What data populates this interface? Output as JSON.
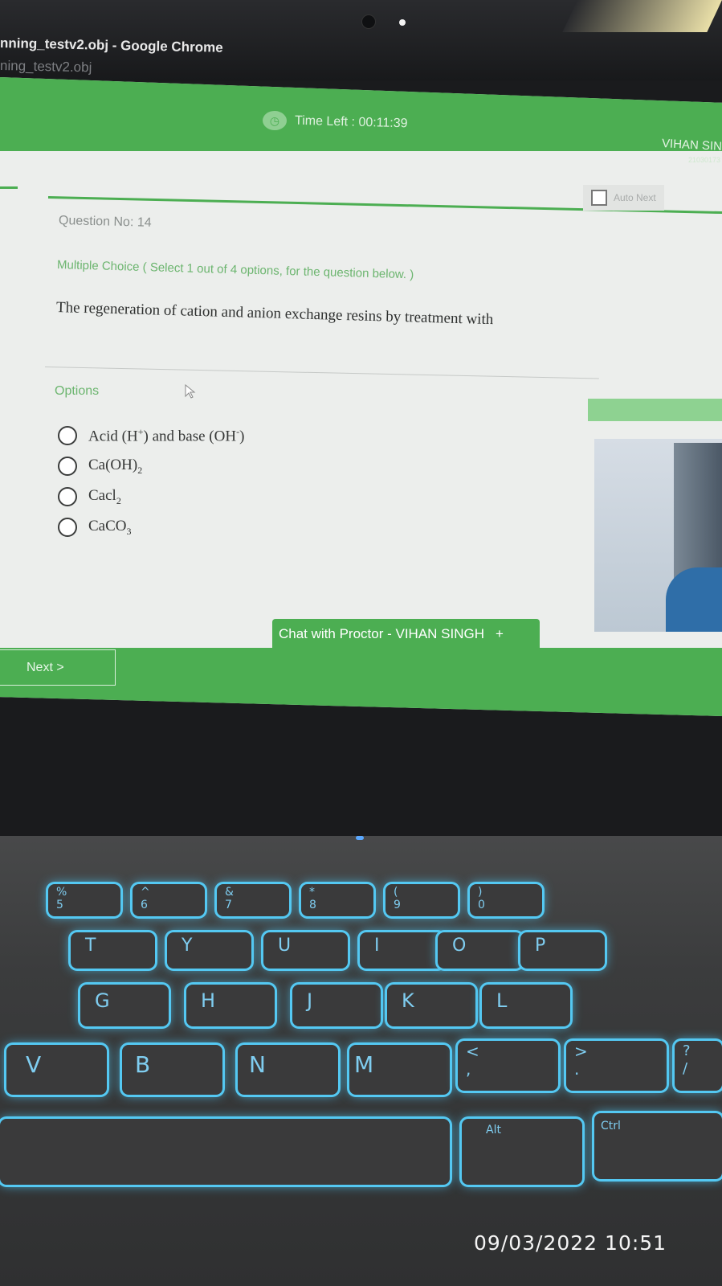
{
  "browser": {
    "window_title": "nning_testv2.obj - Google Chrome",
    "tab_title": "ning_testv2.obj"
  },
  "header": {
    "timer_label": "Time Left : 00:11:39",
    "user_name": "VIHAN SIN",
    "user_id": "21030173"
  },
  "toolbar": {
    "auto_next_label": "Auto Next"
  },
  "question": {
    "number_label": "Question No: 14",
    "type_label": "Multiple Choice ( Select 1 out of 4 options, for the question below. )",
    "text": "The regeneration of cation and anion exchange resins by treatment with"
  },
  "options": {
    "label": "Options",
    "items": [
      {
        "base": "Acid (H",
        "sup": "+",
        "mid": ") and base (OH",
        "sup2": "-",
        "end": ")"
      },
      {
        "base": "Ca(OH)",
        "sub": "2"
      },
      {
        "base": "Cacl",
        "sub": "2"
      },
      {
        "base": "CaCO",
        "sub": "3"
      }
    ],
    "selected": null
  },
  "chat": {
    "label": "Chat with Proctor - VIHAN SINGH",
    "expand_symbol": "+"
  },
  "footer": {
    "next_label": "Next >"
  },
  "keyboard": {
    "row1": [
      "%\n5",
      "^\n6",
      "&\n7",
      "*\n8",
      "(\n9",
      ")\n0"
    ],
    "row2": [
      "T",
      "Y",
      "U",
      "I",
      "O",
      "P"
    ],
    "row3": [
      "G",
      "H",
      "J",
      "K",
      "L"
    ],
    "row4": [
      "V",
      "B",
      "N",
      "M",
      "<\n,",
      ">\n.",
      "?\n/"
    ],
    "row5": [
      "Alt",
      "Ctrl"
    ]
  },
  "photo_timestamp": "09/03/2022 10:51",
  "colors": {
    "primary_green": "#4cae52",
    "key_backlight": "#54c8f2"
  }
}
